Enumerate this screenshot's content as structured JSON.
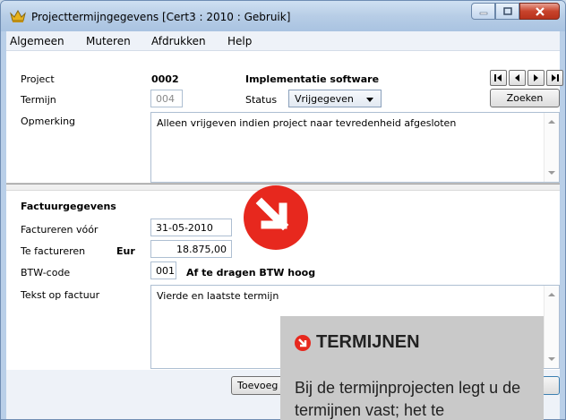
{
  "window": {
    "title": "Projecttermijngegevens  [Cert3 : 2010 : Gebruik]"
  },
  "menu": [
    {
      "label": "Algemeen"
    },
    {
      "label": "Muteren"
    },
    {
      "label": "Afdrukken"
    },
    {
      "label": "Help"
    }
  ],
  "project": {
    "label": "Project",
    "code": "0002",
    "name": "Implementatie software"
  },
  "termijn": {
    "label": "Termijn",
    "value": "004"
  },
  "status": {
    "label": "Status",
    "value": "Vrijgegeven"
  },
  "zoeken_label": "Zoeken",
  "opmerking": {
    "label": "Opmerking",
    "value": "Alleen vrijgeven indien project naar tevredenheid afgesloten"
  },
  "factuur": {
    "heading": "Factuurgegevens",
    "factureren_voor_label": "Factureren vóór",
    "factureren_voor_value": "31-05-2010",
    "te_factureren_label": "Te factureren",
    "currency": "Eur",
    "amount": "18.875,00",
    "btw_label": "BTW-code",
    "btw_code": "001",
    "btw_desc": "Af te dragen BTW hoog",
    "tekst_label": "Tekst op factuur",
    "tekst_value": "Vierde en laatste termijn"
  },
  "toevoegen_label": "Toevoeg",
  "callout": {
    "title": "TERMIJNEN",
    "text": "Bij de termijnprojecten legt u de termijnen vast; het te"
  },
  "colors": {
    "accent_red": "#e7281e",
    "callout_bg": "#c9c9c9"
  }
}
